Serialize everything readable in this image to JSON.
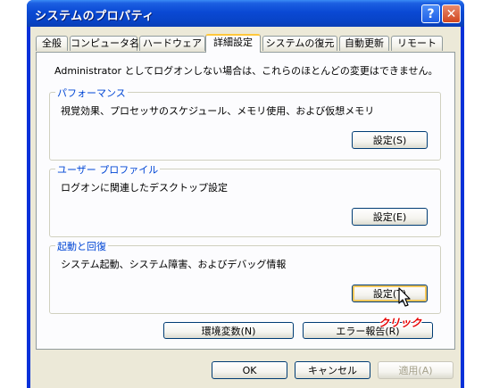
{
  "window": {
    "title": "システムのプロパティ",
    "help_label": "?",
    "close_label": "✕"
  },
  "tabs": [
    {
      "label": "全般"
    },
    {
      "label": "コンピュータ名"
    },
    {
      "label": "ハードウェア"
    },
    {
      "label": "詳細設定",
      "active": true
    },
    {
      "label": "システムの復元"
    },
    {
      "label": "自動更新"
    },
    {
      "label": "リモート"
    }
  ],
  "notice": "Administrator としてログオンしない場合は、これらのほとんどの変更はできません。",
  "groups": {
    "performance": {
      "title": "パフォーマンス",
      "description": "視覚効果、プロセッサのスケジュール、メモリ使用、および仮想メモリ",
      "button": "設定(S)"
    },
    "user_profile": {
      "title": "ユーザー プロファイル",
      "description": "ログオンに関連したデスクトップ設定",
      "button": "設定(E)"
    },
    "startup": {
      "title": "起動と回復",
      "description": "システム起動、システム障害、およびデバッグ情報",
      "button": "設定(T)"
    }
  },
  "buttons": {
    "env_vars": "環境変数(N)",
    "error_report": "エラー報告(R)",
    "ok": "OK",
    "cancel": "キャンセル",
    "apply": "適用(A)"
  },
  "annotation": {
    "click_label": "クリック",
    "color": "#e60000"
  }
}
